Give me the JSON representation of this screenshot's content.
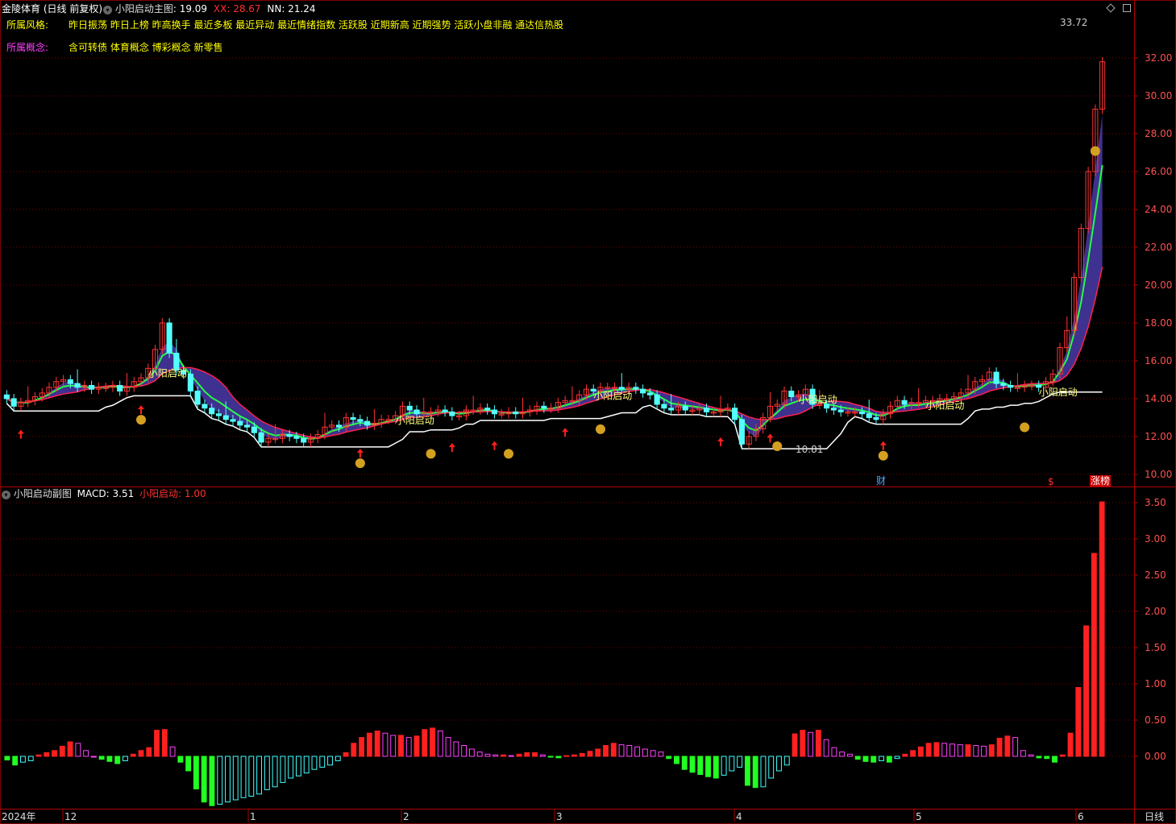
{
  "header": {
    "title": "金陵体育",
    "period_label": "(日线 前复权)",
    "indicator_name": "小阳启动主图",
    "main_value": ": 19.09",
    "xx_label": "XX: 28.67",
    "nn_label": "NN: 21.24"
  },
  "info": {
    "style_label": "所属风格:",
    "style_values": "昨日振荡 昨日上榜 昨高换手 最近多板 最近异动 最近情绪指数 活跃股 近期新高 近期强势 活跃小盘非融 通达信热股",
    "concept_label": "所属概念:",
    "concept_values": "含可转债 体育概念 博彩概念 新零售"
  },
  "sub_header": {
    "title": "小阳启动副图",
    "macd_label": "MACD: 3.51",
    "signal_label": "小阳启动: 1.00"
  },
  "annotations": {
    "max_price": "33.72",
    "min_price": "10.81",
    "signal_text": "小阳启动",
    "cai_label": "财",
    "dollar_label": "$",
    "zhangting_label": "涨榜"
  },
  "footer": {
    "period_button": "日线",
    "month_labels": [
      "2024年",
      "12",
      "1",
      "2",
      "3",
      "4",
      "5",
      "6"
    ]
  },
  "colors": {
    "up": "#ff3333",
    "down": "#54ffff",
    "grid": "#7a0000",
    "axis_text": "#ff5050",
    "macd_pos": "#ff2020",
    "macd_pos_dim": "#ff40ff",
    "macd_neg": "#22ff22",
    "macd_neg_dim": "#40ffff"
  },
  "chart_data": [
    {
      "type": "candlestick",
      "title": "小阳启动主图",
      "ylim": [
        9.4,
        34.3
      ],
      "y_ticks": [
        "32.00",
        "30.00",
        "28.00",
        "26.00",
        "24.00",
        "22.00",
        "20.00",
        "18.00",
        "16.00",
        "14.00",
        "12.00",
        "10.00"
      ],
      "close": [
        14.0,
        13.6,
        13.8,
        13.9,
        14.1,
        14.3,
        14.6,
        14.9,
        15.0,
        14.8,
        14.6,
        14.7,
        14.5,
        14.6,
        14.6,
        14.7,
        14.4,
        14.6,
        14.9,
        15.1,
        15.6,
        16.6,
        18.0,
        16.4,
        15.5,
        15.3,
        14.4,
        13.7,
        13.5,
        13.2,
        13.1,
        12.9,
        12.8,
        12.6,
        12.5,
        12.2,
        11.7,
        11.9,
        11.9,
        12.1,
        12.0,
        11.9,
        11.7,
        11.9,
        12.1,
        12.5,
        12.6,
        12.5,
        13.0,
        12.9,
        12.8,
        12.6,
        12.7,
        12.9,
        12.9,
        13.1,
        13.6,
        13.4,
        13.2,
        13.3,
        13.3,
        13.4,
        13.3,
        13.1,
        13.1,
        13.4,
        13.4,
        13.5,
        13.4,
        13.2,
        13.2,
        13.3,
        13.2,
        13.3,
        13.4,
        13.6,
        13.5,
        13.5,
        13.8,
        13.9,
        13.9,
        14.2,
        14.5,
        14.4,
        14.6,
        14.6,
        14.6,
        14.5,
        14.6,
        14.5,
        14.3,
        14.2,
        13.7,
        13.5,
        13.4,
        13.6,
        13.4,
        13.4,
        13.5,
        13.3,
        13.3,
        13.4,
        13.5,
        12.9,
        11.6,
        12.0,
        12.4,
        13.0,
        13.6,
        13.7,
        14.4,
        14.1,
        14.2,
        14.5,
        13.7,
        13.7,
        13.5,
        13.4,
        13.3,
        13.3,
        13.3,
        13.2,
        13.0,
        12.9,
        13.2,
        13.6,
        13.9,
        13.7,
        13.8,
        13.8,
        13.9,
        13.9,
        14.0,
        14.0,
        14.1,
        14.3,
        14.5,
        14.9,
        15.0,
        15.4,
        14.8,
        14.7,
        14.6,
        14.6,
        14.7,
        14.7,
        14.6,
        14.9,
        15.3,
        16.7,
        17.6,
        20.4,
        23.0,
        26.0,
        29.3,
        31.8
      ],
      "open": [
        14.2,
        14.0,
        13.6,
        13.8,
        13.9,
        14.1,
        14.3,
        14.6,
        14.9,
        15.0,
        14.8,
        14.6,
        14.7,
        14.5,
        14.6,
        14.6,
        14.7,
        14.4,
        14.6,
        14.9,
        15.1,
        15.6,
        16.6,
        18.0,
        16.4,
        15.5,
        15.3,
        14.4,
        13.7,
        13.5,
        13.2,
        13.1,
        12.9,
        12.8,
        12.6,
        12.5,
        12.2,
        11.7,
        11.9,
        11.9,
        12.1,
        12.0,
        11.9,
        11.7,
        11.9,
        12.1,
        12.5,
        12.6,
        12.5,
        13.0,
        12.9,
        12.8,
        12.6,
        12.7,
        12.9,
        12.9,
        13.1,
        13.6,
        13.4,
        13.2,
        13.3,
        13.3,
        13.4,
        13.3,
        13.1,
        13.1,
        13.4,
        13.4,
        13.5,
        13.4,
        13.2,
        13.2,
        13.3,
        13.2,
        13.3,
        13.4,
        13.6,
        13.5,
        13.5,
        13.8,
        13.9,
        13.9,
        14.2,
        14.5,
        14.4,
        14.6,
        14.6,
        14.6,
        14.5,
        14.6,
        14.5,
        14.3,
        14.2,
        13.7,
        13.5,
        13.4,
        13.6,
        13.4,
        13.4,
        13.5,
        13.3,
        13.3,
        13.4,
        13.5,
        12.9,
        11.6,
        12.0,
        12.4,
        13.0,
        13.6,
        13.7,
        14.4,
        14.1,
        14.2,
        14.5,
        13.7,
        13.7,
        13.5,
        13.4,
        13.3,
        13.3,
        13.3,
        13.2,
        13.0,
        12.9,
        13.2,
        13.6,
        13.9,
        13.7,
        13.8,
        13.8,
        13.9,
        13.9,
        14.0,
        14.0,
        14.1,
        14.3,
        14.5,
        14.9,
        15.0,
        15.4,
        14.8,
        14.7,
        14.6,
        14.6,
        14.7,
        14.7,
        14.6,
        14.9,
        15.3,
        16.7,
        17.6,
        20.4,
        23.0,
        26.0,
        29.3
      ],
      "high_max": 33.72,
      "low_min": 10.81
    },
    {
      "type": "bar",
      "title": "小阳启动副图",
      "ylim": [
        -0.7,
        3.6
      ],
      "y_ticks": [
        "3.50",
        "3.00",
        "2.50",
        "2.00",
        "1.50",
        "1.00",
        "0.50",
        "0.00"
      ],
      "values": [
        -0.05,
        -0.12,
        -0.08,
        -0.06,
        0.02,
        0.05,
        0.08,
        0.14,
        0.2,
        0.18,
        0.08,
        0.0,
        -0.04,
        -0.07,
        -0.1,
        -0.06,
        0.03,
        0.08,
        0.12,
        0.36,
        0.37,
        0.13,
        -0.08,
        -0.2,
        -0.45,
        -0.63,
        -0.68,
        -0.66,
        -0.63,
        -0.6,
        -0.57,
        -0.55,
        -0.52,
        -0.46,
        -0.42,
        -0.36,
        -0.3,
        -0.27,
        -0.23,
        -0.18,
        -0.15,
        -0.12,
        -0.06,
        0.05,
        0.18,
        0.26,
        0.32,
        0.35,
        0.32,
        0.29,
        0.29,
        0.26,
        0.28,
        0.37,
        0.39,
        0.35,
        0.26,
        0.2,
        0.15,
        0.1,
        0.06,
        0.03,
        0.02,
        0.02,
        0.01,
        0.03,
        0.05,
        0.05,
        0.02,
        -0.01,
        -0.02,
        0.01,
        0.02,
        0.04,
        0.07,
        0.1,
        0.15,
        0.18,
        0.16,
        0.15,
        0.13,
        0.1,
        0.08,
        0.06,
        -0.03,
        -0.1,
        -0.18,
        -0.22,
        -0.25,
        -0.28,
        -0.3,
        -0.26,
        -0.2,
        -0.15,
        -0.4,
        -0.43,
        -0.42,
        -0.3,
        -0.2,
        -0.12,
        0.31,
        0.36,
        0.33,
        0.36,
        0.23,
        0.12,
        0.06,
        0.03,
        -0.04,
        -0.07,
        -0.08,
        -0.06,
        -0.08,
        -0.03,
        0.03,
        0.08,
        0.13,
        0.18,
        0.19,
        0.18,
        0.17,
        0.16,
        0.16,
        0.15,
        0.14,
        0.16,
        0.25,
        0.28,
        0.26,
        0.08,
        0.02,
        -0.02,
        -0.03,
        -0.08,
        0.02,
        0.32,
        0.95,
        1.8,
        2.8,
        3.51
      ]
    }
  ]
}
